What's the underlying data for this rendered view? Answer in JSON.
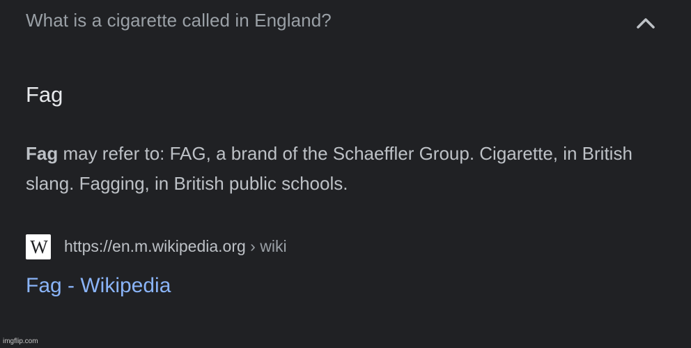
{
  "question": {
    "text": "What is a cigarette called in England?",
    "toggle_icon": "chevron-up-icon"
  },
  "answer": {
    "title": "Fag",
    "snippet_bold": "Fag",
    "snippet_rest": " may refer to: FAG, a brand of the Schaeffler Group. Cigarette, in British slang. Fagging, in British public schools."
  },
  "source": {
    "favicon_icon": "wikipedia-icon",
    "favicon_text": "W",
    "url": "https://en.m.wikipedia.org",
    "breadcrumb": " › wiki",
    "link_title": "Fag - Wikipedia"
  },
  "watermark": "imgflip.com",
  "colors": {
    "background": "#202124",
    "question": "#9aa0a6",
    "title": "#e8eaed",
    "snippet": "#bdc1c6",
    "link": "#8ab4f8"
  }
}
